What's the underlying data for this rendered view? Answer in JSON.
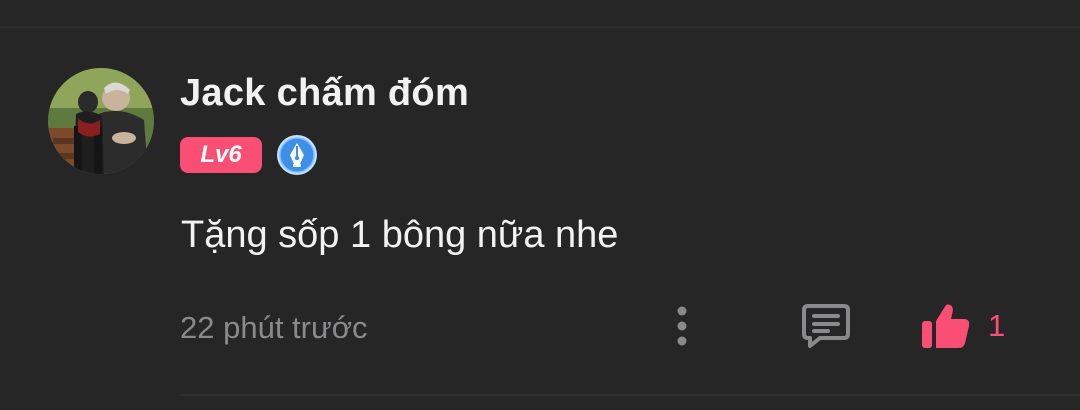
{
  "comment": {
    "author": {
      "name": "Jack chấm đóm",
      "level": "Lv6",
      "avatar_icon": "user-avatar-photo",
      "badge_icon": "fountain-pen-icon"
    },
    "text": "Tặng sốp 1 bông nữa nhe",
    "timestamp": "22 phút trước",
    "actions": {
      "more_icon": "more-vertical-icon",
      "reply_icon": "reply-comment-icon",
      "like_icon": "thumbs-up-icon",
      "like_count": "1"
    }
  },
  "colors": {
    "background": "#262627",
    "accent": "#fb4e74",
    "primary_text": "#f2f2f2",
    "secondary_text": "#8a8a8c",
    "badge_blue": "#3d8fe8"
  }
}
